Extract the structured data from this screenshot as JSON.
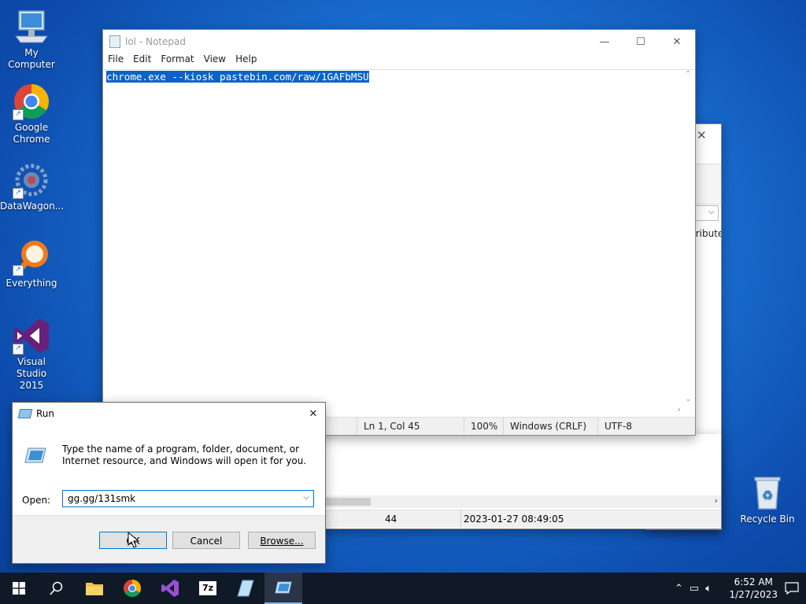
{
  "desktop": {
    "icons": [
      {
        "label": "My Computer"
      },
      {
        "label": "Google Chrome"
      },
      {
        "label": "DataWagon..."
      },
      {
        "label": "Everything"
      },
      {
        "label": "Visual Studio 2015"
      },
      {
        "label": "Recycle Bin"
      }
    ]
  },
  "notepad": {
    "title": "lol - Notepad",
    "menu": [
      "File",
      "Edit",
      "Format",
      "View",
      "Help"
    ],
    "content": "chrome.exe --kiosk pastebin.com/raw/1GAFbMSU",
    "status": {
      "position": "Ln 1, Col 45",
      "zoom": "100%",
      "line_ending": "Windows (CRLF)",
      "encoding": "UTF-8"
    }
  },
  "bg_window": {
    "column_fragment": "tribute",
    "row_count": "44",
    "timestamp": "2023-01-27 08:49:05"
  },
  "run": {
    "title": "Run",
    "description": "Type the name of a program, folder, document, or Internet resource, and Windows will open it for you.",
    "open_label": "Open:",
    "input_value": "gg.gg/131smk",
    "ok_label": "OK",
    "cancel_label": "Cancel",
    "browse_label": "Browse..."
  },
  "taskbar": {
    "time": "6:52 AM",
    "date": "1/27/2023"
  },
  "colors": {
    "selection": "#0a64c8",
    "taskbar": "#101a27",
    "accent": "#0078d7"
  }
}
